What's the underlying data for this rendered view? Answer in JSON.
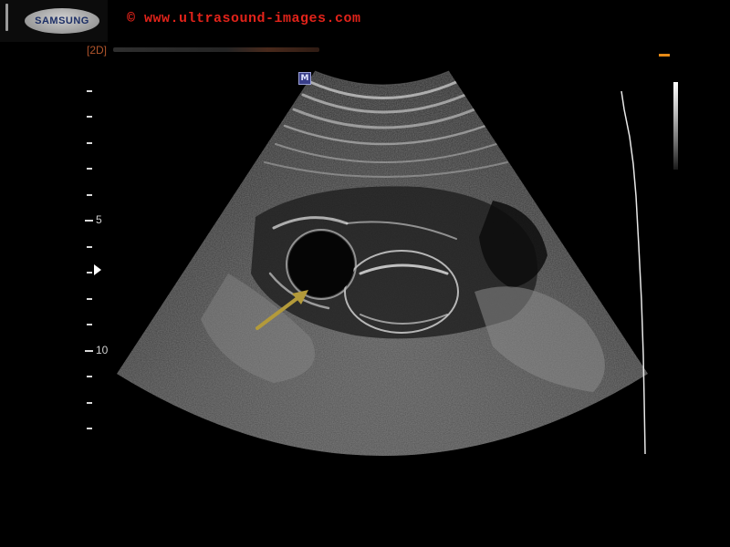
{
  "banner": {
    "brand_logo_text": "SAMSUNG",
    "copyright_text": "© www.ultrasound-images.com"
  },
  "image_info": {
    "mode_label": "[2D]"
  },
  "orientation_marker": "M",
  "depth_scale": {
    "labels": [
      "5",
      "10"
    ]
  },
  "annotation": {
    "arrow_color": "#b39a3a"
  },
  "colors": {
    "copyright": "#e2231a",
    "mode_label": "#b1552c",
    "accent_dash": "#e58a17",
    "marker_bg": "#3a3f8a"
  }
}
